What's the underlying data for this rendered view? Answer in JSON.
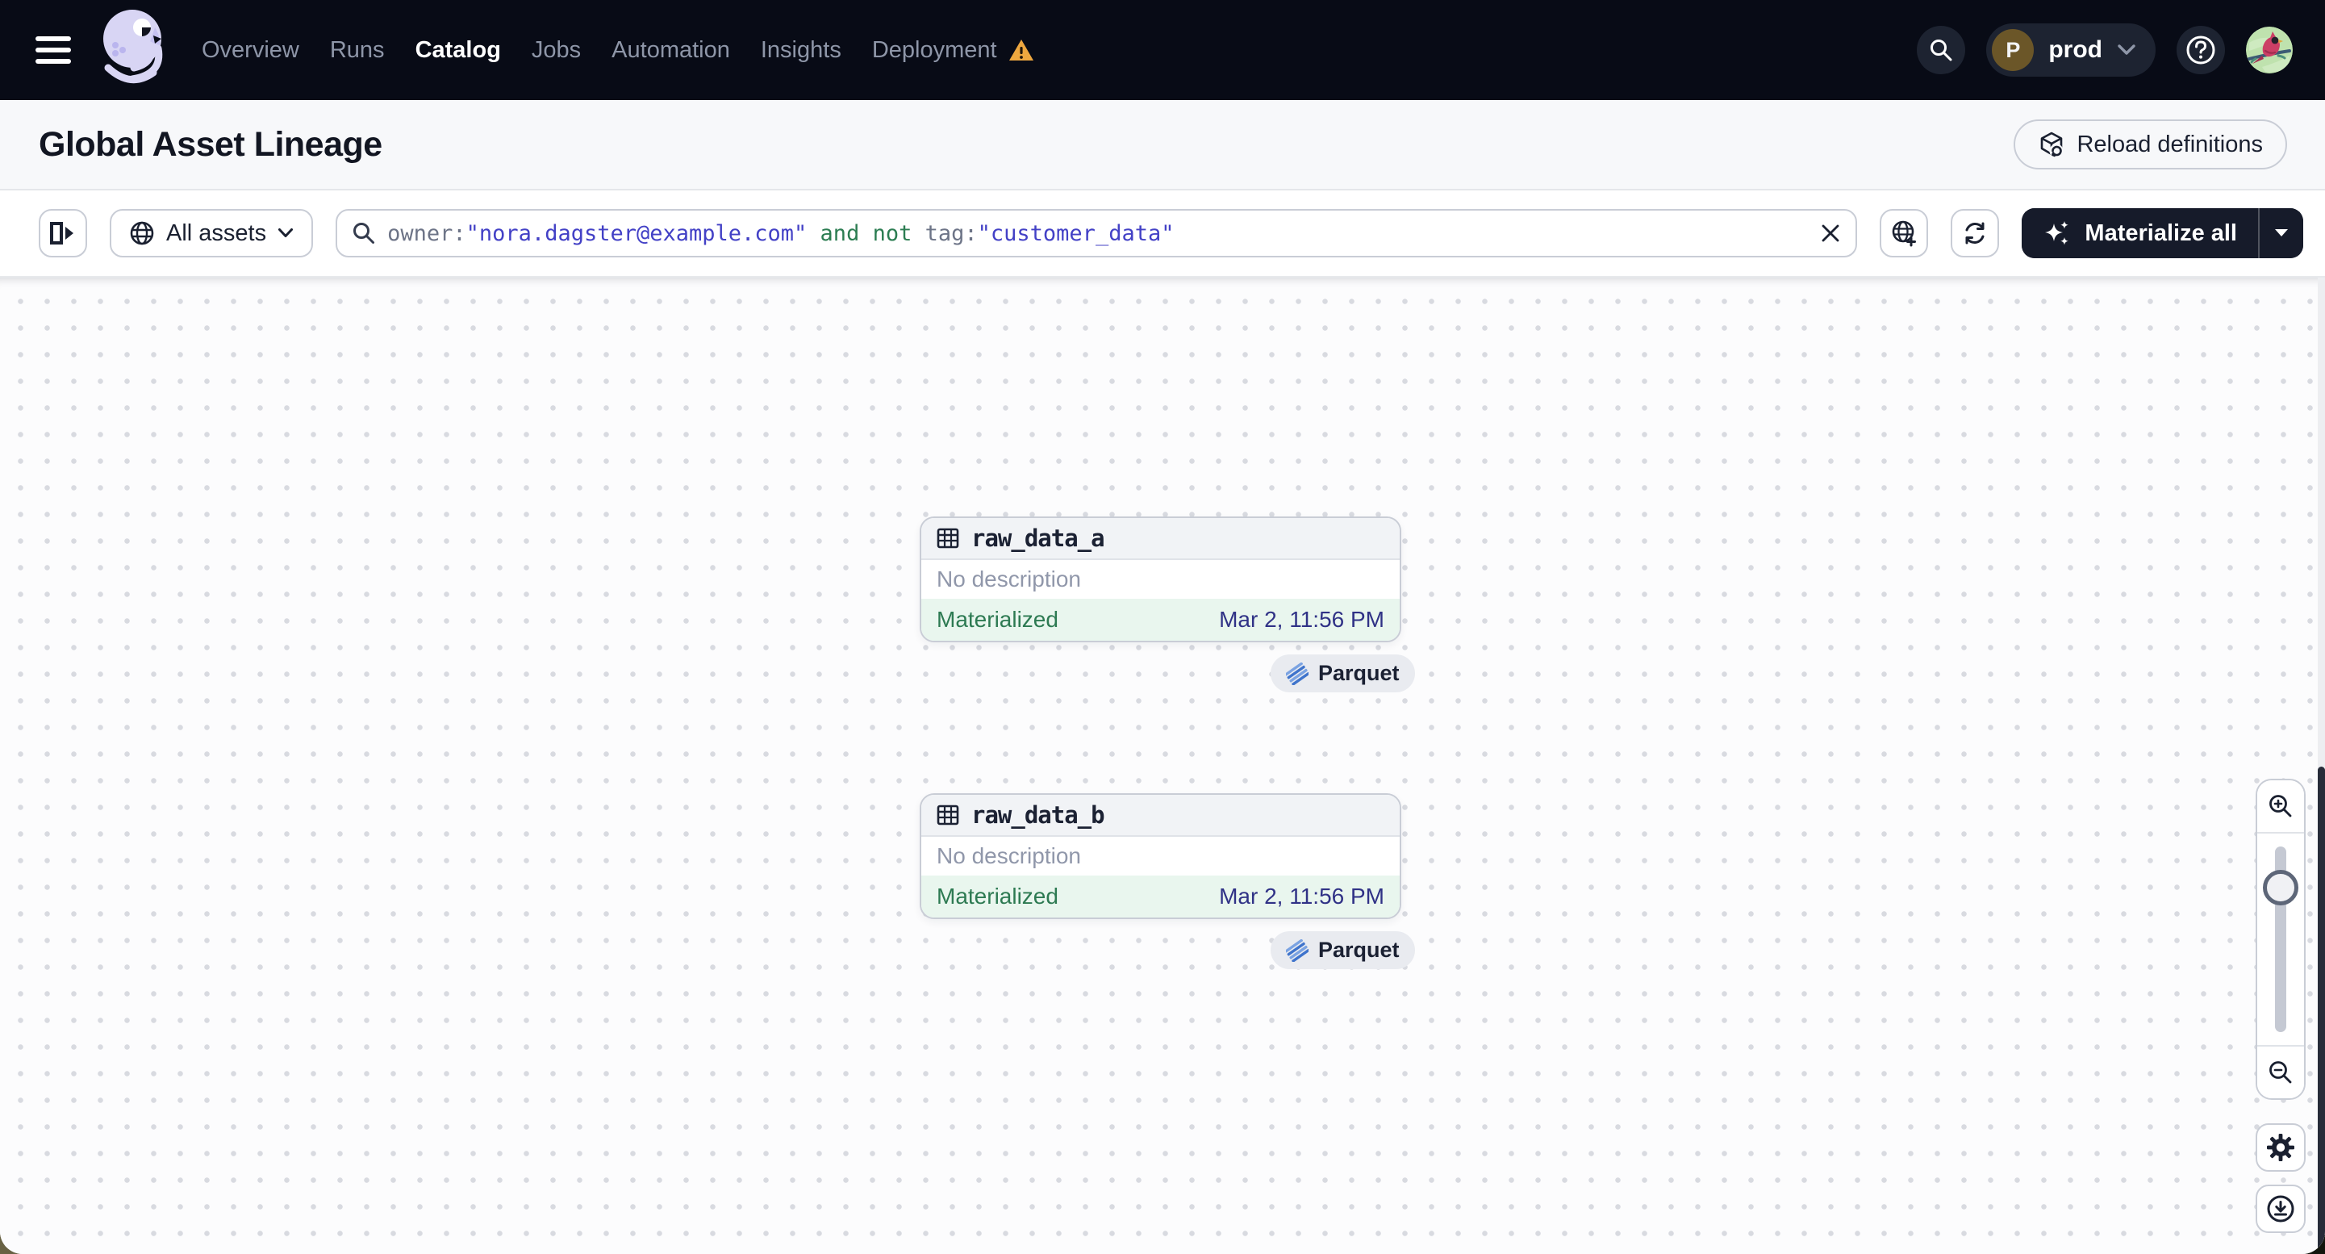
{
  "topbar": {
    "nav": [
      {
        "label": "Overview"
      },
      {
        "label": "Runs"
      },
      {
        "label": "Catalog",
        "active": true
      },
      {
        "label": "Jobs"
      },
      {
        "label": "Automation"
      },
      {
        "label": "Insights"
      },
      {
        "label": "Deployment",
        "warning": true
      }
    ],
    "deployment_switcher": {
      "initial": "P",
      "name": "prod"
    }
  },
  "header": {
    "title": "Global Asset Lineage",
    "reload_button_label": "Reload definitions"
  },
  "filterbar": {
    "scope_button_label": "All assets",
    "search": {
      "segments": [
        {
          "type": "key",
          "text": "owner:"
        },
        {
          "type": "value",
          "text": "\"nora.dagster@example.com\""
        },
        {
          "type": "operator",
          "text": " and not "
        },
        {
          "type": "key",
          "text": "tag:"
        },
        {
          "type": "value",
          "text": "\"customer_data\""
        }
      ]
    },
    "materialize_button_label": "Materialize all"
  },
  "graph": {
    "nodes": [
      {
        "name": "raw_data_a",
        "description": "No description",
        "status": "Materialized",
        "materialized_at": "Mar 2, 11:56 PM",
        "storage_badge": "Parquet"
      },
      {
        "name": "raw_data_b",
        "description": "No description",
        "status": "Materialized",
        "materialized_at": "Mar 2, 11:56 PM",
        "storage_badge": "Parquet"
      }
    ]
  },
  "colors": {
    "topbar_bg": "#080b16",
    "dark_button_bg": "#161b2a",
    "status_materialized_text": "#2d7a52",
    "status_materialized_bg": "#e9f6ee",
    "timestamp_text": "#303286",
    "query_key": "#6d7487",
    "query_value": "#4341c6",
    "query_operator": "#2c7d52",
    "warning_orange": "#eda73f",
    "parquet_blue_dark": "#3f74cc",
    "parquet_blue_light": "#7ba3e2",
    "logo_lavender": "#d8d5f4"
  }
}
